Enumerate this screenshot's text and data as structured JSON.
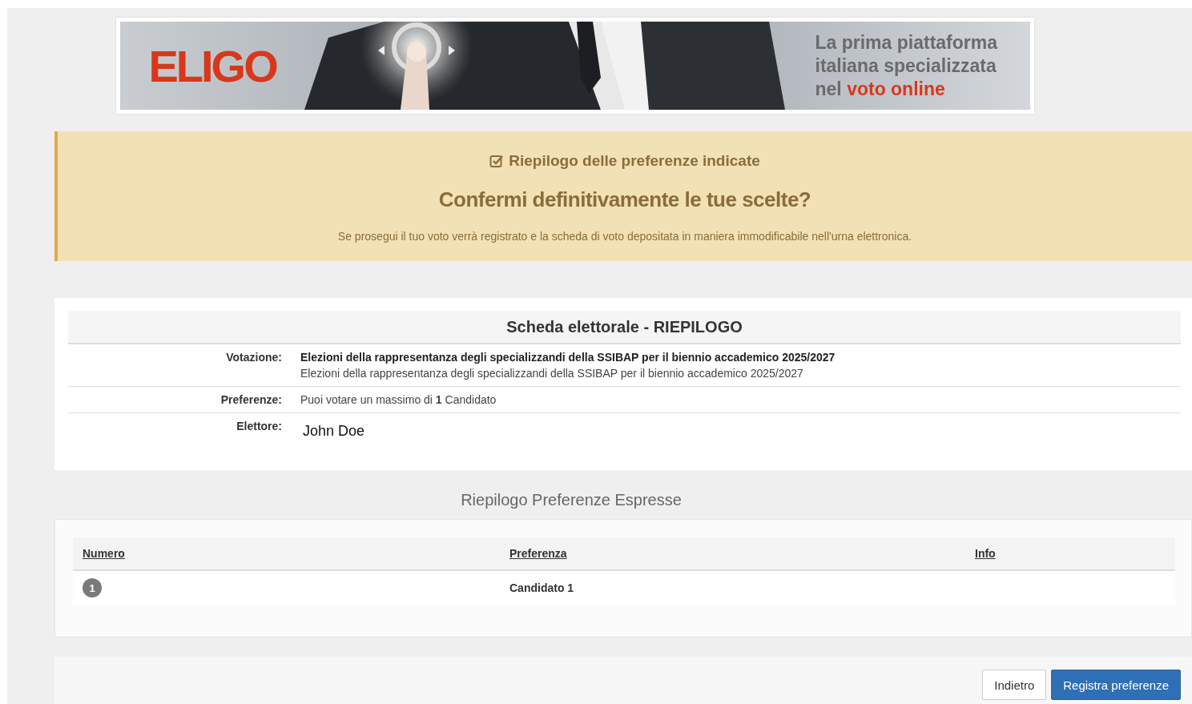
{
  "banner": {
    "logo": "ELIGO",
    "tagline": "La prima piattaforma italiana specializzata nel **voto online**"
  },
  "alert": {
    "title": "Riepilogo delle preferenze indicate",
    "heading": "Confermi definitivamente le tue scelte?",
    "message": "Se prosegui il tuo voto verrà registrato e la scheda di voto depositata in maniera immodificabile nell'urna elettronica."
  },
  "summary": {
    "title": "Scheda elettorale - RIEPILOGO",
    "rows": [
      {
        "kind": "election",
        "label": "Votazione:",
        "value": "Elezioni della rappresentanza degli specializzandi della SSIBAP per il biennio accademico 2025/2027",
        "description": "Elezioni della rappresentanza degli specializzandi della SSIBAP per il biennio accademico 2025/2027"
      },
      {
        "kind": "text",
        "label": "Preferenze:",
        "value": "Puoi votare un massimo di **1** Candidato"
      },
      {
        "kind": "voter",
        "label": "Elettore:",
        "value": "John Doe"
      }
    ]
  },
  "preferences": {
    "title": "Riepilogo Preferenze Espresse",
    "columns": [
      "Numero",
      "Preferenza",
      "Info"
    ],
    "rows": [
      {
        "number": "1",
        "preference": "Candidato 1"
      }
    ]
  },
  "buttons": [
    {
      "label": "Indietro",
      "kind": "default"
    },
    {
      "label": "Registra preferenze",
      "kind": "primary"
    }
  ]
}
